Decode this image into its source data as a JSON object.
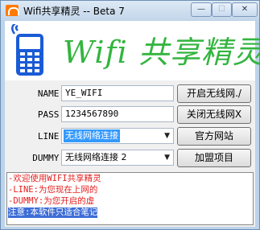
{
  "window": {
    "title": "Wifi共享精灵 -- Beta 7",
    "controls": {
      "minimize": "—",
      "maximize": "☐",
      "close": "✕"
    }
  },
  "banner": {
    "title": "Wifi 共享精灵",
    "logo_icon": "phone-wifi-icon",
    "colors": {
      "title": "#33b53f",
      "logo": "#1a5bd6"
    }
  },
  "form": {
    "name": {
      "label": "NAME:",
      "value": "YE_WIFI"
    },
    "pass": {
      "label": "PASS:",
      "value": "1234567890"
    },
    "line": {
      "label": "LINE:",
      "value": "无线网络连接"
    },
    "dummy": {
      "label": "DUMMY:",
      "value": "无线网络连接 2"
    }
  },
  "buttons": {
    "start": "开启无线网./",
    "stop": "关闭无线网X",
    "website": "官方网站",
    "join": "加盟项目"
  },
  "log": [
    "-欢迎使用WIFI共享精灵",
    "-LINE:为您现在上网的",
    "-DUMMY:为您开启的虚",
    "注意:本软件只适合笔记"
  ]
}
